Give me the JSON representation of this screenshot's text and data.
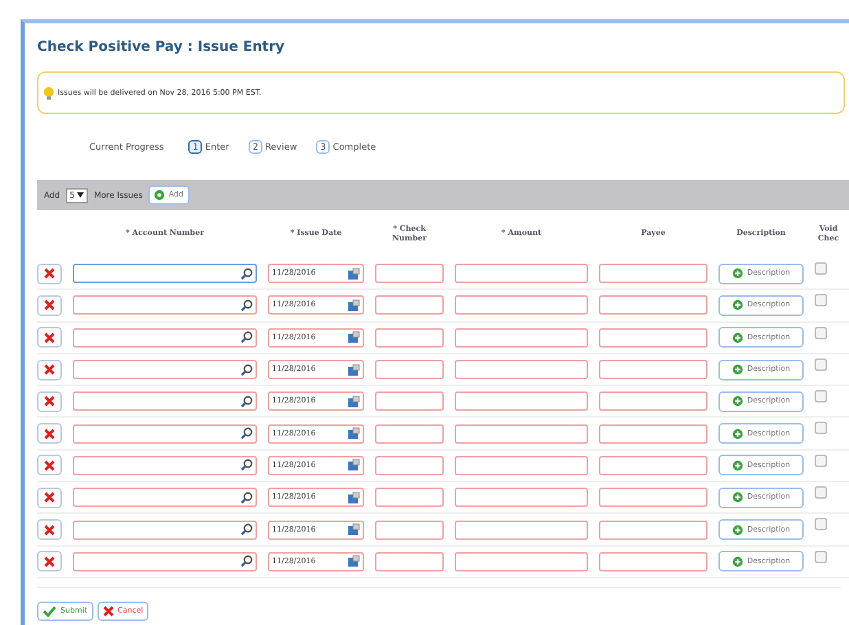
{
  "window": {
    "title": "Check Positive Pay : Issue Entry"
  },
  "notice": "Issues will be delivered on Nov 28, 2016 5:00 PM EST.",
  "progress": {
    "label": "Current Progress",
    "steps": [
      {
        "number": "1",
        "label": "Enter",
        "selected": true
      },
      {
        "number": "2",
        "label": "Review",
        "selected": false
      },
      {
        "number": "3",
        "label": "Complete",
        "selected": false
      }
    ]
  },
  "toolbar": {
    "prefix": "Add",
    "count": "5",
    "suffix": "More Issues",
    "button": "Add"
  },
  "columns": [
    "* Account Number",
    "* Issue Date",
    "* Check\nNumber",
    "* Amount",
    "Payee",
    "Description",
    "Void\nChec"
  ],
  "rows": [
    {
      "issue_date": "11/28/2016",
      "description": "Description",
      "focused": true,
      "void": false
    },
    {
      "issue_date": "11/28/2016",
      "description": "Description",
      "focused": false,
      "void": false
    },
    {
      "issue_date": "11/28/2016",
      "description": "Description",
      "focused": false,
      "void": false
    },
    {
      "issue_date": "11/28/2016",
      "description": "Description",
      "focused": false,
      "void": false
    },
    {
      "issue_date": "11/28/2016",
      "description": "Description",
      "focused": false,
      "void": false
    },
    {
      "issue_date": "11/28/2016",
      "description": "Description",
      "focused": false,
      "void": false
    },
    {
      "issue_date": "11/28/2016",
      "description": "Description",
      "focused": false,
      "void": false
    },
    {
      "issue_date": "11/28/2016",
      "description": "Description",
      "focused": false,
      "void": false
    },
    {
      "issue_date": "11/28/2016",
      "description": "Description",
      "focused": false,
      "void": false
    },
    {
      "issue_date": "11/28/2016",
      "description": "Description",
      "focused": false,
      "void": false
    }
  ],
  "buttons": [
    {
      "kind": "submit",
      "label": "Submit"
    },
    {
      "kind": "cancel",
      "label": "Cancel"
    }
  ]
}
